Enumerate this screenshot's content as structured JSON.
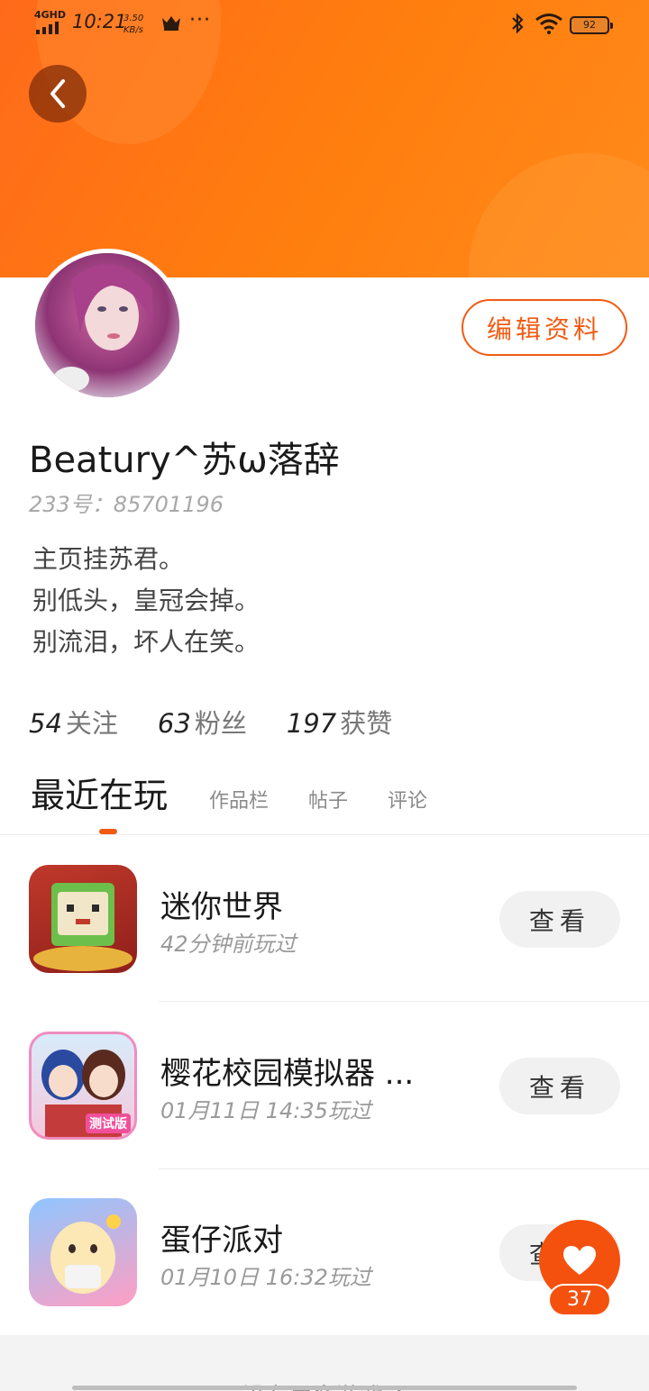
{
  "status_bar": {
    "network": "4GHD",
    "time": "10:21",
    "speed_value": "3.50",
    "speed_unit": "KB/s",
    "battery": "92"
  },
  "profile": {
    "name": "Beatury^苏ω落辞",
    "uid_label": "233号：85701196",
    "edit_label": "编辑资料",
    "bio": [
      "主页挂苏君。",
      "别低头，皇冠会掉。",
      "别流泪，坏人在笑。"
    ],
    "stats": [
      {
        "num": "54",
        "label": "关注"
      },
      {
        "num": "63",
        "label": "粉丝"
      },
      {
        "num": "197",
        "label": "获赞"
      }
    ]
  },
  "tabs": [
    "最近在玩",
    "作品栏",
    "帖子",
    "评论"
  ],
  "games": [
    {
      "title": "迷你世界",
      "time": "42分钟前玩过",
      "button": "查看"
    },
    {
      "title": "樱花校园模拟器 ...",
      "time": "01月11日 14:35玩过",
      "button": "查看"
    },
    {
      "title": "蛋仔派对",
      "time": "01月10日 16:32玩过",
      "button": "查看"
    }
  ],
  "game_icon_badge": "测试版",
  "footer": "没有更多游戏了",
  "fab": {
    "count": "37"
  },
  "colors": {
    "accent": "#f4510f",
    "header": "#ff7f0e"
  },
  "icons": [
    "back-arrow-icon",
    "heart-icon",
    "bluetooth-icon",
    "wifi-icon",
    "crown-icon"
  ]
}
